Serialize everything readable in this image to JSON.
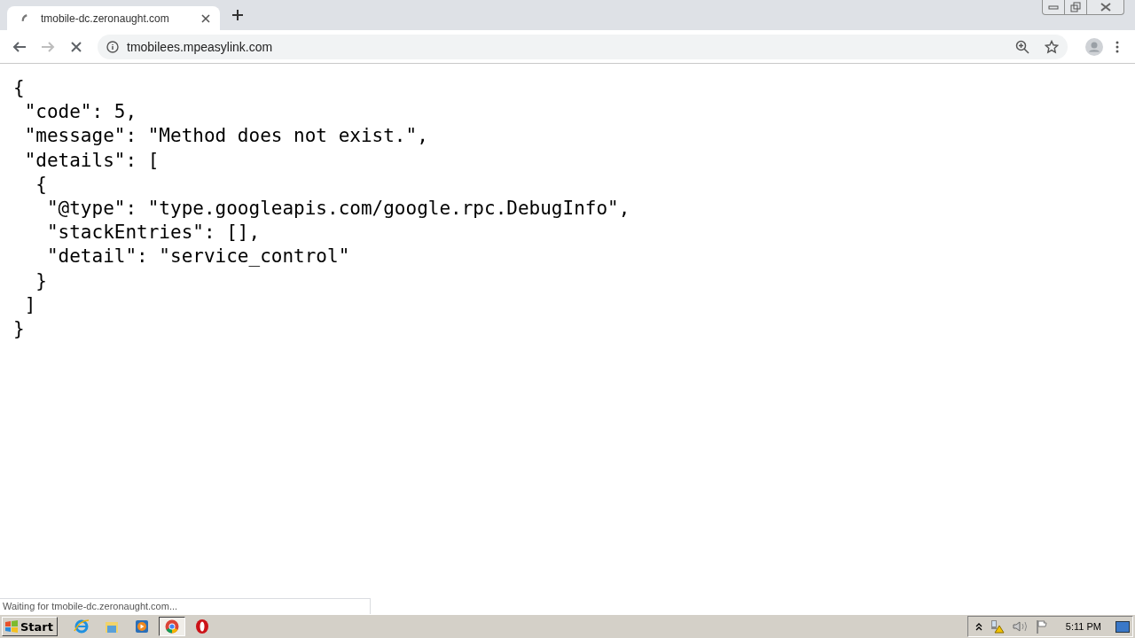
{
  "tabs": [
    {
      "title": "tmobile-dc.zeronaught.com",
      "selected": true,
      "loading": true
    }
  ],
  "nav_buttons": [
    {
      "kind": "back",
      "disabled": false
    },
    {
      "kind": "forward",
      "disabled": true
    },
    {
      "kind": "stop",
      "disabled": false
    }
  ],
  "address_bar": {
    "value": "tmobilees.mpeasylink.com"
  },
  "page": {
    "lines": [
      "{",
      " \"code\": 5,",
      " \"message\": \"Method does not exist.\",",
      " \"details\": [",
      "  {",
      "   \"@type\": \"type.googleapis.com/google.rpc.DebugInfo\",",
      "   \"stackEntries\": [],",
      "   \"detail\": \"service_control\"",
      "  }",
      " ]",
      "}"
    ]
  },
  "status_bubble": "Waiting for tmobile-dc.zeronaught.com...",
  "taskbar": {
    "start": "Start",
    "apps": [
      {
        "kind": "ie",
        "selected": false
      },
      {
        "kind": "explorer",
        "selected": false
      },
      {
        "kind": "media",
        "selected": false
      },
      {
        "kind": "chrome",
        "selected": true
      },
      {
        "kind": "opera",
        "selected": false
      }
    ],
    "clock": "5:11 PM"
  }
}
